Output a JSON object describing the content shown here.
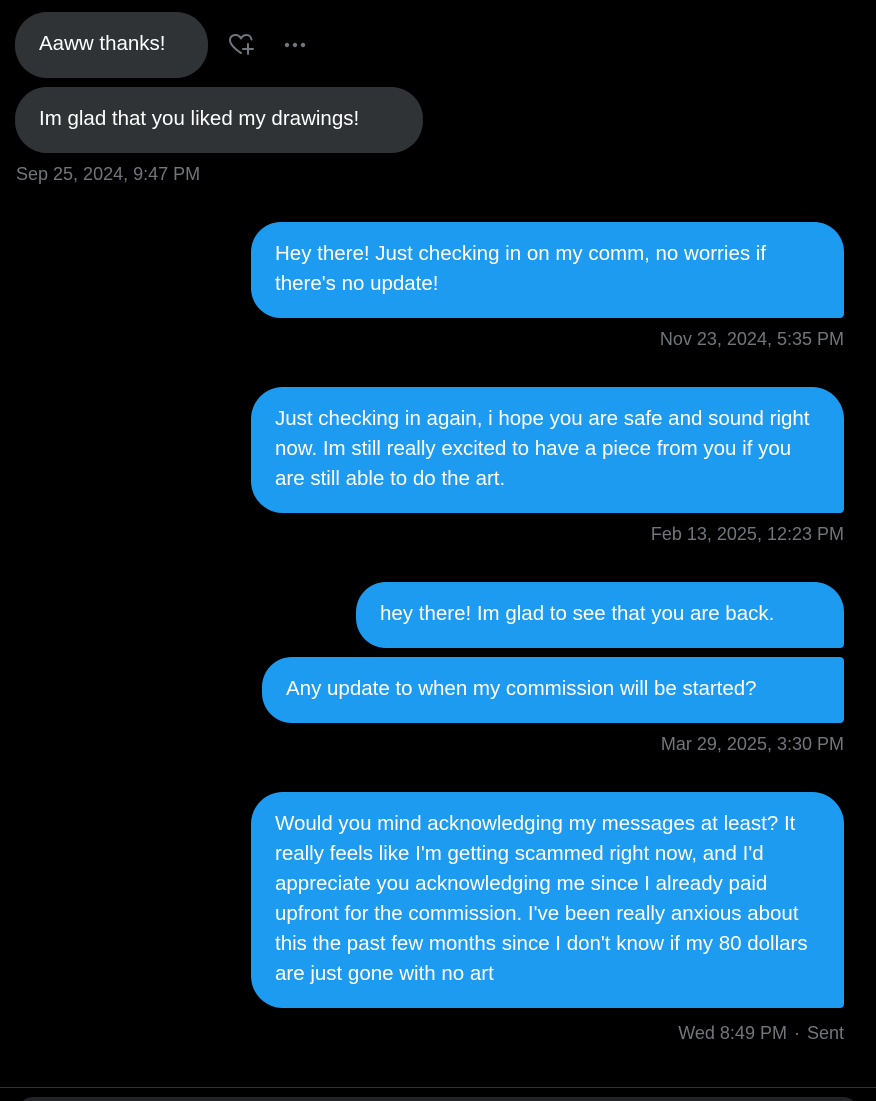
{
  "messages": {
    "received": [
      {
        "text": "Aaww thanks!"
      },
      {
        "text": "Im glad that you liked my drawings!"
      }
    ],
    "received_timestamp": "Sep 25, 2024, 9:47 PM",
    "sent_1": {
      "text": "Hey there! Just checking in on my comm, no worries if there's no update!",
      "timestamp": "Nov 23, 2024, 5:35 PM"
    },
    "sent_2": {
      "text": "Just checking in again, i hope you are safe and sound right now. Im still really excited to have a piece from you if you are still able to do the art.",
      "timestamp": "Feb 13, 2025, 12:23 PM"
    },
    "sent_3a": {
      "text": "hey there! Im glad to see that you are back."
    },
    "sent_3b": {
      "text": "Any update to when my commission will be started?"
    },
    "sent_3_timestamp": "Mar 29, 2025, 3:30 PM",
    "sent_4": {
      "text": "Would you mind acknowledging my messages at least? It really feels like I'm getting scammed right now, and I'd appreciate you acknowledging me since I already paid upfront for the commission. I've been really anxious about this the past few months since I don't know if my 80 dollars are just gone with no art",
      "timestamp": "Wed 8:49 PM",
      "status_separator": "·",
      "status": "Sent"
    }
  },
  "actions": {
    "react_icon": "heart-plus-icon",
    "more_icon": "more-horizontal-icon"
  },
  "colors": {
    "background": "#000000",
    "received_bubble": "#2f3336",
    "sent_bubble": "#1d9bf0",
    "timestamp": "#71767b",
    "text": "#ffffff"
  }
}
